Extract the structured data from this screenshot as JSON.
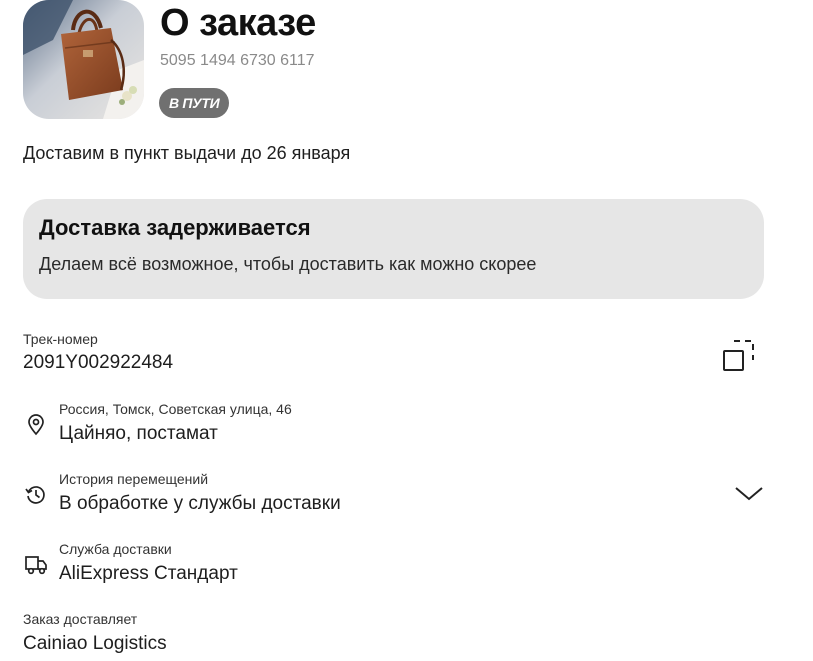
{
  "header": {
    "title": "О заказе",
    "order_number": "5095 1494 6730 6117",
    "status": "В ПУТИ"
  },
  "delivery_estimate": "Доставим в пункт выдачи до 26 января",
  "alert": {
    "title": "Доставка задерживается",
    "text": "Делаем всё возможное, чтобы доставить как можно скорее"
  },
  "tracking": {
    "label": "Трек-номер",
    "value": "2091Y002922484",
    "copy_icon": "copy-icon"
  },
  "address": {
    "label": "Россия, Томск, Советская улица, 46",
    "value": "Цайняо, постамат",
    "icon": "location-pin-icon"
  },
  "history": {
    "label": "История перемещений",
    "value": "В обработке у службы доставки",
    "icon": "history-icon",
    "expand_icon": "chevron-down-icon"
  },
  "service": {
    "label": "Служба доставки",
    "value": "AliExpress Стандарт",
    "icon": "truck-icon"
  },
  "carrier": {
    "label": "Заказ доставляет",
    "value": "Cainiao Logistics"
  }
}
